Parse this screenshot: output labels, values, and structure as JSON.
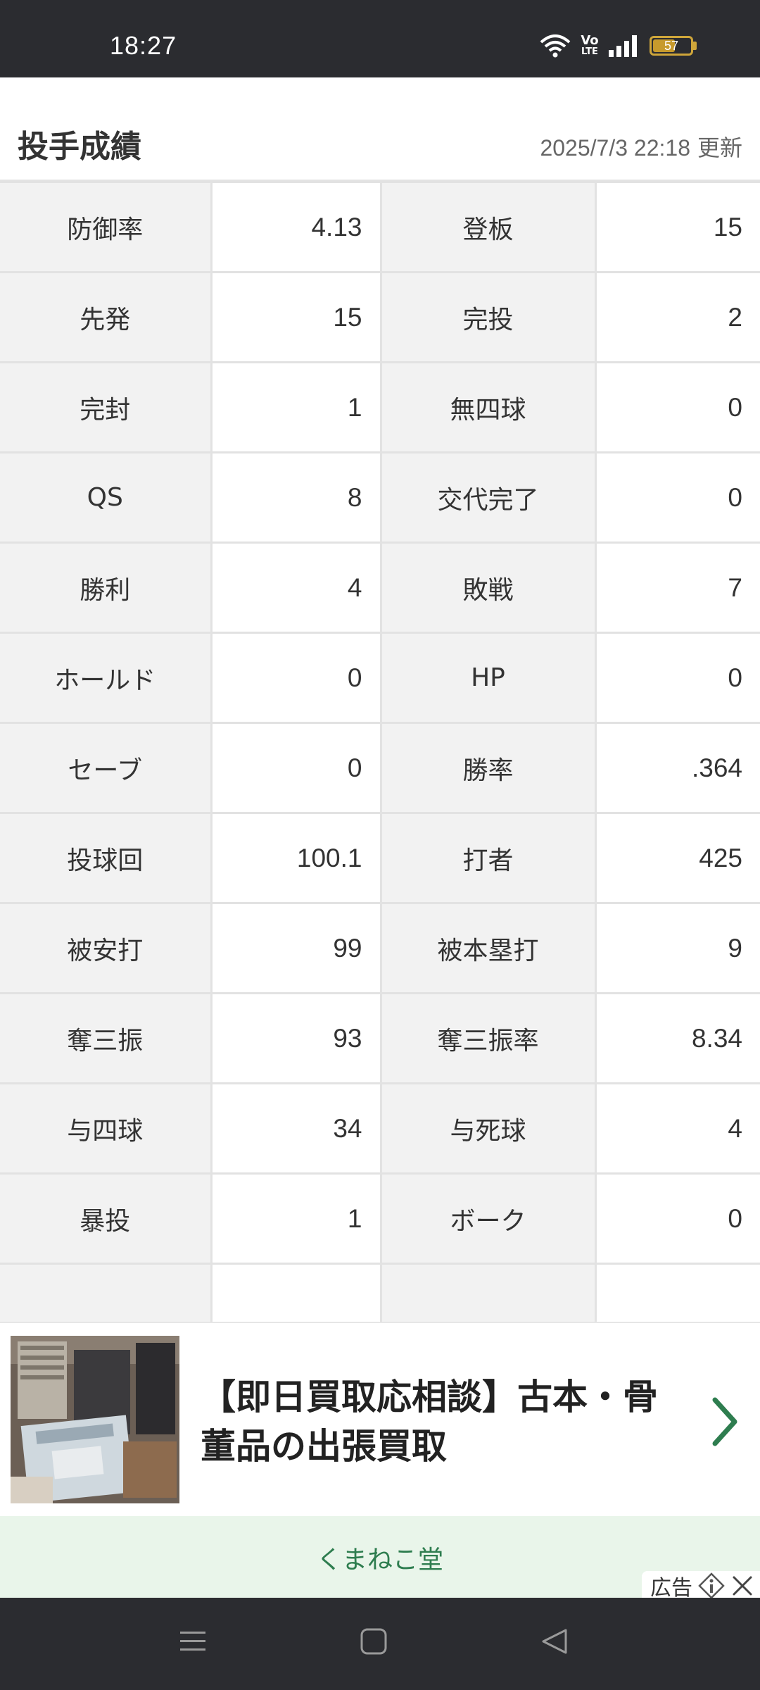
{
  "status_bar": {
    "time": "18:27",
    "battery": "57",
    "volte_top": "Vo",
    "volte_bottom": "LTE",
    "icons": [
      "wifi-icon",
      "volte-icon",
      "signal-icon",
      "battery-icon"
    ]
  },
  "header": {
    "title": "投手成績",
    "updated_date": "2025/7/3 22:18",
    "updated_label": "更新"
  },
  "stats": [
    {
      "l1": "防御率",
      "v1": "4.13",
      "l2": "登板",
      "v2": "15"
    },
    {
      "l1": "先発",
      "v1": "15",
      "l2": "完投",
      "v2": "2"
    },
    {
      "l1": "完封",
      "v1": "1",
      "l2": "無四球",
      "v2": "0"
    },
    {
      "l1": "QS",
      "v1": "8",
      "l2": "交代完了",
      "v2": "0"
    },
    {
      "l1": "勝利",
      "v1": "4",
      "l2": "敗戦",
      "v2": "7"
    },
    {
      "l1": "ホールド",
      "v1": "0",
      "l2": "HP",
      "v2": "0"
    },
    {
      "l1": "セーブ",
      "v1": "0",
      "l2": "勝率",
      "v2": ".364"
    },
    {
      "l1": "投球回",
      "v1": "100.1",
      "l2": "打者",
      "v2": "425"
    },
    {
      "l1": "被安打",
      "v1": "99",
      "l2": "被本塁打",
      "v2": "9"
    },
    {
      "l1": "奪三振",
      "v1": "93",
      "l2": "奪三振率",
      "v2": "8.34"
    },
    {
      "l1": "与四球",
      "v1": "34",
      "l2": "与死球",
      "v2": "4"
    },
    {
      "l1": "暴投",
      "v1": "1",
      "l2": "ボーク",
      "v2": "0"
    },
    {
      "l1": "",
      "v1": "",
      "l2": "",
      "v2": ""
    }
  ],
  "ad": {
    "title": "【即日買取応相談】古本・骨董品の出張買取",
    "sponsor": "くまねこ堂",
    "label": "広告",
    "colors": {
      "sponsor_bg": "#e9f5ea",
      "accent": "#2e7d4f"
    }
  },
  "nav_bar": {
    "icons": [
      "menu-icon",
      "home-icon",
      "back-icon"
    ]
  }
}
